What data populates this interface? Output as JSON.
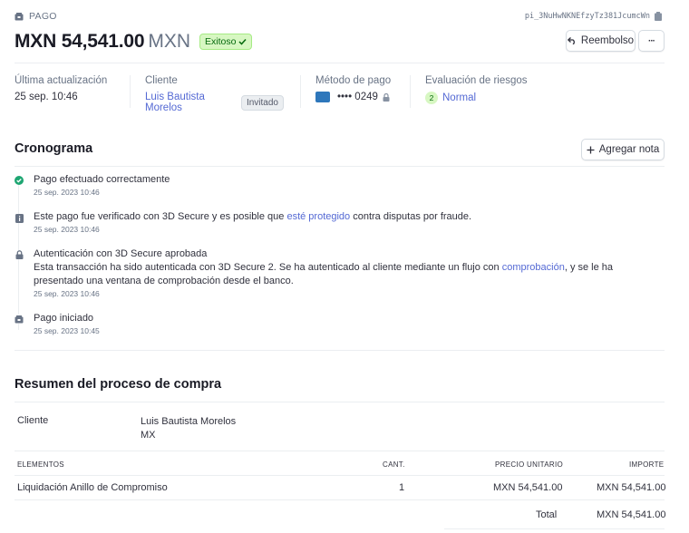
{
  "header": {
    "section_label": "PAGO",
    "payment_id": "pi_3NuHwNKNEfzyTz381JcumcWn",
    "amount": "MXN 54,541.00",
    "currency": "MXN",
    "status": "Exitoso",
    "refund_label": "Reembolso",
    "more_label": "···"
  },
  "summary": {
    "last_update_label": "Última actualización",
    "last_update_value": "25 sep. 10:46",
    "customer_label": "Cliente",
    "customer_name": "Luis Bautista Morelos",
    "customer_tag": "Invitado",
    "payment_method_label": "Método de pago",
    "card_last4": "•••• 0249",
    "risk_label": "Evaluación de riesgos",
    "risk_score": "2",
    "risk_value": "Normal"
  },
  "timeline": {
    "title": "Cronograma",
    "add_note_label": "Agregar nota",
    "events": [
      {
        "text": "Pago efectuado correctamente",
        "date": "25 sep. 2023 10:46",
        "icon": "check-icon"
      },
      {
        "text_before": "Este pago fue verificado con 3D Secure y es posible que ",
        "link": "esté protegido",
        "text_after": " contra disputas por fraude.",
        "date": "25 sep. 2023 10:46",
        "icon": "info-shield-icon"
      },
      {
        "title": "Autenticación con 3D Secure aprobada",
        "text_before": "Esta transacción ha sido autenticada con 3D Secure 2. Se ha autenticado al cliente mediante un flujo con ",
        "link": "comprobación",
        "text_after": ", y se le ha presentado una ventana de comprobación desde el banco.",
        "date": "25 sep. 2023 10:46",
        "icon": "lock-icon"
      },
      {
        "text": "Pago iniciado",
        "date": "25 sep. 2023 10:45",
        "icon": "payment-icon"
      }
    ]
  },
  "checkout": {
    "title": "Resumen del proceso de compra",
    "customer_label": "Cliente",
    "customer_name": "Luis Bautista Morelos",
    "customer_country": "MX",
    "columns": [
      "ELEMENTOS",
      "CANT.",
      "PRECIO UNITARIO",
      "IMPORTE"
    ],
    "items": [
      {
        "name": "Liquidación Anillo de Compromiso",
        "qty": "1",
        "unit_price": "MXN 54,541.00",
        "amount": "MXN 54,541.00"
      }
    ],
    "total_label": "Total",
    "total_value": "MXN 54,541.00"
  },
  "colors": {
    "accent": "#5469d4",
    "success_bg": "#d7f7c2",
    "success_text": "#05690d"
  }
}
